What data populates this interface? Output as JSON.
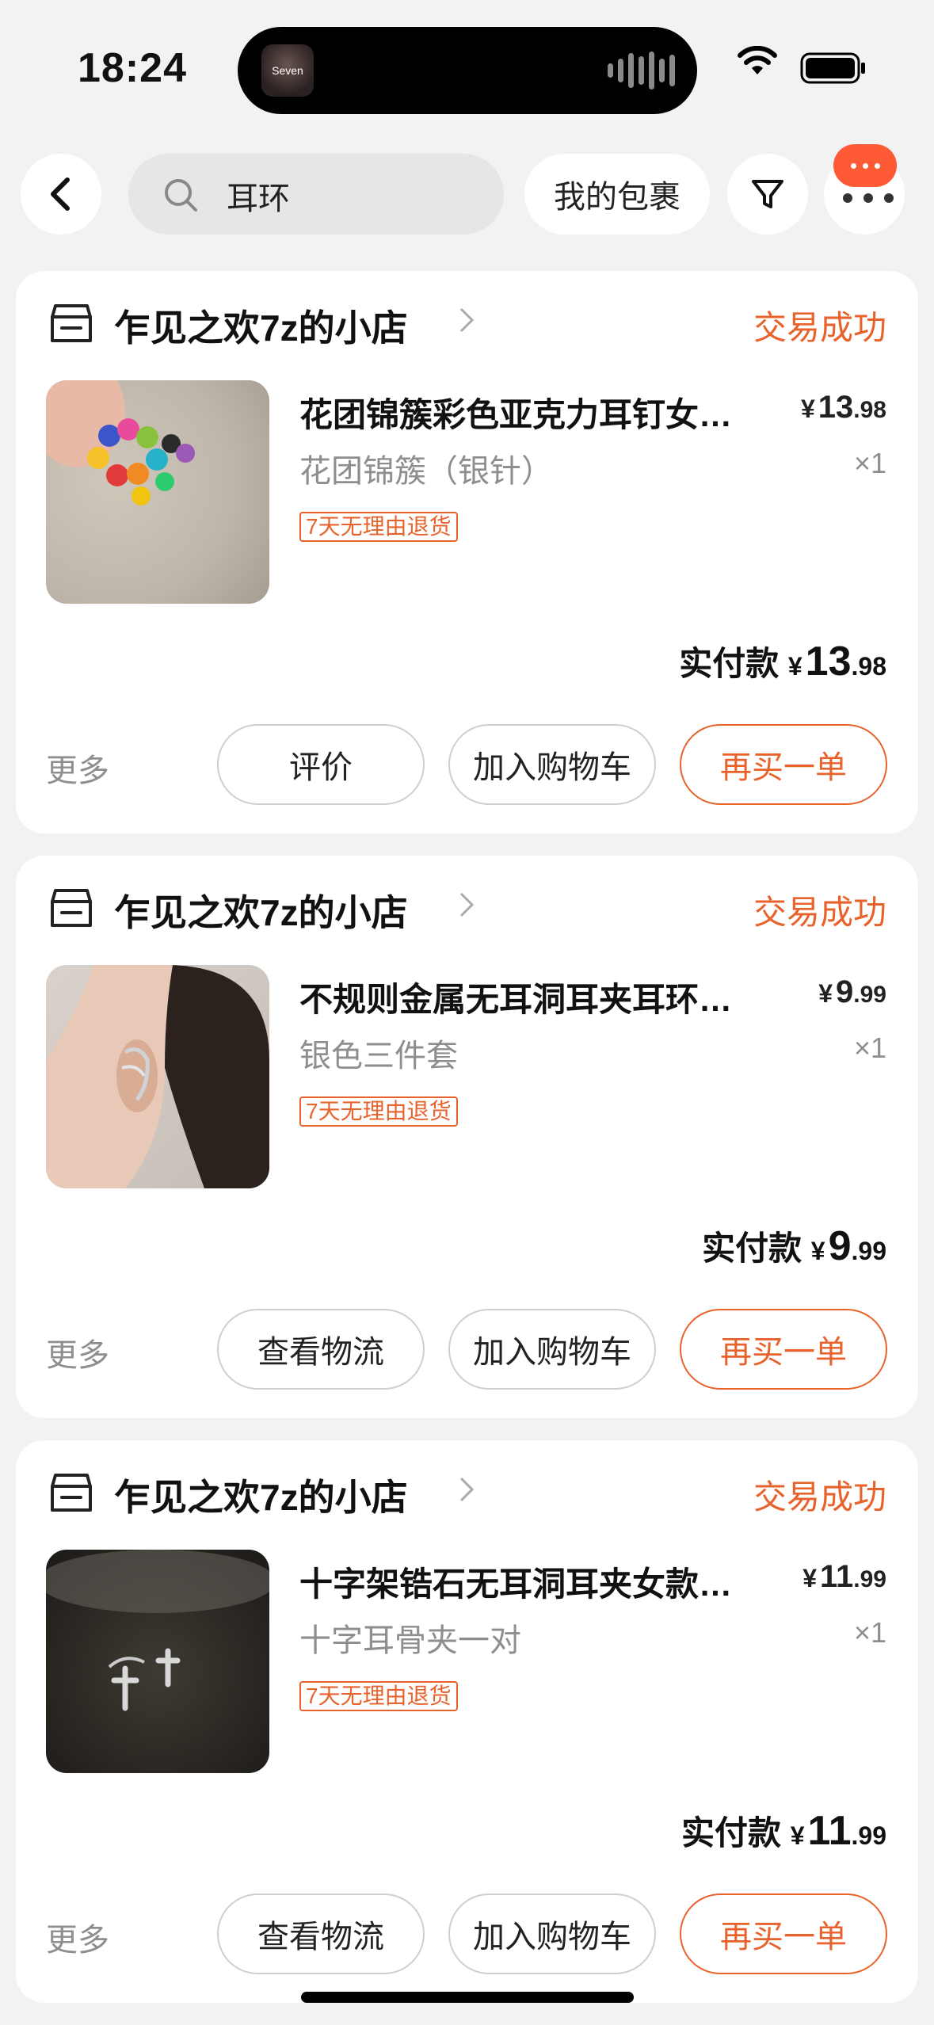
{
  "status_bar": {
    "time": "18:24",
    "island_app": "Seven"
  },
  "top_bar": {
    "search_query": "耳环",
    "package_button": "我的包裹"
  },
  "orders": [
    {
      "shop_name": "乍见之欢7z的小店",
      "status": "交易成功",
      "title": "花团锦簇彩色亚克力耳钉女…",
      "variant": "花团锦簇（银针）",
      "currency": "¥",
      "price_int": "13",
      "price_dec": ".98",
      "quantity": "×1",
      "return_tag": "7天无理由退货",
      "paid_label": "实付款",
      "paid_int": "13",
      "paid_dec": ".98",
      "more": "更多",
      "buttons": [
        "评价",
        "加入购物车",
        "再买一单"
      ]
    },
    {
      "shop_name": "乍见之欢7z的小店",
      "status": "交易成功",
      "title": "不规则金属无耳洞耳夹耳环…",
      "variant": "银色三件套",
      "currency": "¥",
      "price_int": "9",
      "price_dec": ".99",
      "quantity": "×1",
      "return_tag": "7天无理由退货",
      "paid_label": "实付款",
      "paid_int": "9",
      "paid_dec": ".99",
      "more": "更多",
      "buttons": [
        "查看物流",
        "加入购物车",
        "再买一单"
      ]
    },
    {
      "shop_name": "乍见之欢7z的小店",
      "status": "交易成功",
      "title": "十字架锆石无耳洞耳夹女款…",
      "variant": "十字耳骨夹一对",
      "currency": "¥",
      "price_int": "11",
      "price_dec": ".99",
      "quantity": "×1",
      "return_tag": "7天无理由退货",
      "paid_label": "实付款",
      "paid_int": "11",
      "paid_dec": ".99",
      "more": "更多",
      "buttons": [
        "查看物流",
        "加入购物车",
        "再买一单"
      ]
    }
  ],
  "colors": {
    "accent": "#e8632c",
    "badge": "#ff5a36",
    "background": "#f2f2f2"
  },
  "icons": [
    "back-icon",
    "search-icon",
    "filter-icon",
    "more-icon",
    "shop-icon",
    "chevron-right-icon",
    "wifi-icon",
    "battery-icon"
  ]
}
